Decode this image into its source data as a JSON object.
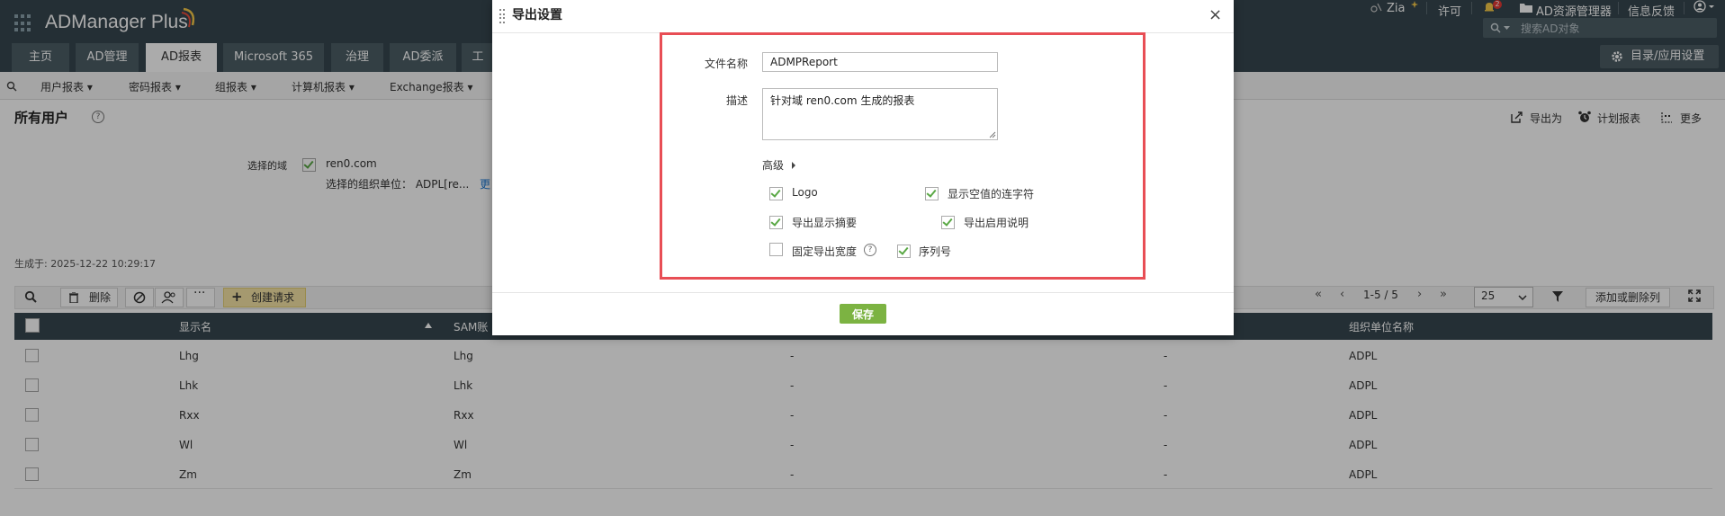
{
  "header": {
    "app_title": "ADManager Plus",
    "zia": "Zia",
    "license": "许可",
    "notification_count": "2",
    "ad_explorer": "AD资源管理器",
    "feedback": "信息反馈",
    "search_placeholder": "搜索AD对象"
  },
  "nav": {
    "tabs": [
      "主页",
      "AD管理",
      "AD报表",
      "Microsoft 365",
      "治理",
      "AD委派",
      "工"
    ],
    "catalog_label": "目录/应用设置"
  },
  "submenu": [
    "用户报表",
    "密码报表",
    "组报表",
    "计算机报表",
    "Exchange报表"
  ],
  "page": {
    "title": "所有用户",
    "export_label": "导出为",
    "schedule_label": "计划报表",
    "more_label": "更多",
    "domain_label": "选择的域",
    "domain_value": "ren0.com",
    "ou_text": "选择的组织单位： ADPL[re...",
    "ou_more": "更",
    "generated": "生成于: 2025-12-22 10:29:17"
  },
  "toolbar": {
    "delete": "删除",
    "create_request": "创建请求",
    "page_range": "1-5 / 5",
    "page_size": "25",
    "add_remove_cols": "添加或删除列"
  },
  "table": {
    "headers": [
      "显示名",
      "SAM账",
      "组织单位名称"
    ],
    "rows": [
      [
        "Lhg",
        "Lhg",
        "-",
        "-",
        "ADPL"
      ],
      [
        "Lhk",
        "Lhk",
        "-",
        "-",
        "ADPL"
      ],
      [
        "Rxx",
        "Rxx",
        "-",
        "-",
        "ADPL"
      ],
      [
        "Wl",
        "Wl",
        "-",
        "-",
        "ADPL"
      ],
      [
        "Zm",
        "Zm",
        "-",
        "-",
        "ADPL"
      ]
    ]
  },
  "modal": {
    "title": "导出设置",
    "filename_label": "文件名称",
    "filename_value": "ADMPReport",
    "desc_label": "描述",
    "desc_value": "针对域 ren0.com 生成的报表",
    "advanced": "高级",
    "opt_logo": "Logo",
    "opt_hyphen": "显示空值的连字符",
    "opt_summary": "导出显示摘要",
    "opt_enable_desc": "导出启用说明",
    "opt_fixed_width": "固定导出宽度",
    "opt_serial": "序列号",
    "save": "保存"
  },
  "colors": {
    "accent_green": "#7cb342",
    "header_bg": "#37474f",
    "highlight_red": "#e84e55"
  }
}
